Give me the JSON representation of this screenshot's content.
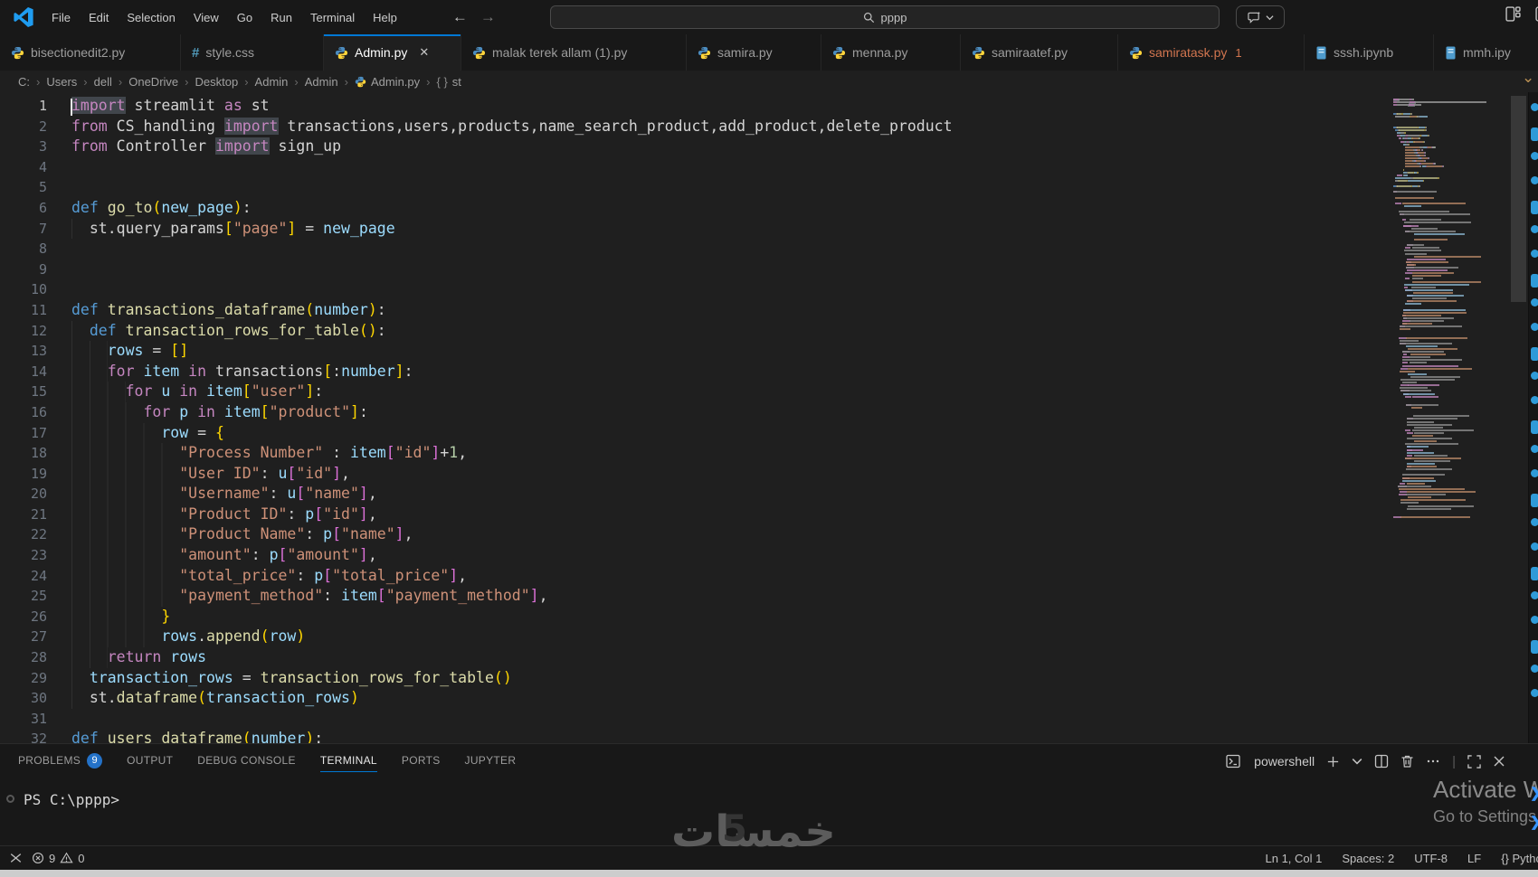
{
  "titlebar": {
    "menus": [
      "File",
      "Edit",
      "Selection",
      "View",
      "Go",
      "Run",
      "Terminal",
      "Help"
    ],
    "search_value": "pppp"
  },
  "tabs": [
    {
      "label": "bisectionedit2.py",
      "icon": "python"
    },
    {
      "label": "style.css",
      "icon": "css"
    },
    {
      "label": "Admin.py",
      "icon": "python",
      "active": true,
      "close": true
    },
    {
      "label": "malak terek allam (1).py",
      "icon": "python"
    },
    {
      "label": "samira.py",
      "icon": "python"
    },
    {
      "label": "menna.py",
      "icon": "python"
    },
    {
      "label": "samiraatef.py",
      "icon": "python"
    },
    {
      "label": "samiratask.py",
      "icon": "python",
      "badge": "1",
      "error": true
    },
    {
      "label": "sssh.ipynb",
      "icon": "notebook"
    },
    {
      "label": "mmh.ipy",
      "icon": "notebook"
    }
  ],
  "breadcrumbs": [
    {
      "label": "C:"
    },
    {
      "label": "Users"
    },
    {
      "label": "dell"
    },
    {
      "label": "OneDrive"
    },
    {
      "label": "Desktop"
    },
    {
      "label": "Admin"
    },
    {
      "label": "Admin"
    },
    {
      "label": "Admin.py",
      "icon": "python"
    },
    {
      "label": "st",
      "icon": "braces"
    }
  ],
  "code": {
    "lines": [
      {
        "n": 1,
        "ind": 0,
        "t": [
          [
            "k hl cur",
            "import"
          ],
          [
            "p",
            " streamlit "
          ],
          [
            "k",
            "as"
          ],
          [
            "p",
            " st"
          ]
        ]
      },
      {
        "n": 2,
        "ind": 0,
        "t": [
          [
            "k",
            "from"
          ],
          [
            "p",
            " CS_handling "
          ],
          [
            "k hl",
            "import"
          ],
          [
            "p",
            " transactions,users,products,name_search_product,add_product,delete_product"
          ]
        ]
      },
      {
        "n": 3,
        "ind": 0,
        "t": [
          [
            "k",
            "from"
          ],
          [
            "p",
            " Controller "
          ],
          [
            "k hl",
            "import"
          ],
          [
            "p",
            " sign_up"
          ]
        ]
      },
      {
        "n": 4,
        "ind": 0,
        "t": []
      },
      {
        "n": 5,
        "ind": 0,
        "t": []
      },
      {
        "n": 6,
        "ind": 0,
        "t": [
          [
            "d",
            "def"
          ],
          [
            "p",
            " "
          ],
          [
            "f",
            "go_to"
          ],
          [
            "b1",
            "("
          ],
          [
            "v",
            "new_page"
          ],
          [
            "b1",
            ")"
          ],
          [
            "p",
            ":"
          ]
        ]
      },
      {
        "n": 7,
        "ind": 2,
        "t": [
          [
            "p",
            "st.query_params"
          ],
          [
            "b1",
            "["
          ],
          [
            "s",
            "\"page\""
          ],
          [
            "b1",
            "]"
          ],
          [
            "p",
            " = "
          ],
          [
            "v",
            "new_page"
          ]
        ]
      },
      {
        "n": 8,
        "ind": 0,
        "t": []
      },
      {
        "n": 9,
        "ind": 0,
        "t": []
      },
      {
        "n": 10,
        "ind": 0,
        "t": []
      },
      {
        "n": 11,
        "ind": 0,
        "t": [
          [
            "d",
            "def"
          ],
          [
            "p",
            " "
          ],
          [
            "f",
            "transactions_dataframe"
          ],
          [
            "b1",
            "("
          ],
          [
            "v",
            "number"
          ],
          [
            "b1",
            ")"
          ],
          [
            "p",
            ":"
          ]
        ]
      },
      {
        "n": 12,
        "ind": 2,
        "t": [
          [
            "d",
            "def"
          ],
          [
            "p",
            " "
          ],
          [
            "f",
            "transaction_rows_for_table"
          ],
          [
            "b1",
            "()"
          ],
          [
            "p",
            ":"
          ]
        ]
      },
      {
        "n": 13,
        "ind": 4,
        "t": [
          [
            "v",
            "rows"
          ],
          [
            "p",
            " = "
          ],
          [
            "b1",
            "[]"
          ]
        ]
      },
      {
        "n": 14,
        "ind": 4,
        "t": [
          [
            "k",
            "for"
          ],
          [
            "p",
            " "
          ],
          [
            "v",
            "item"
          ],
          [
            "p",
            " "
          ],
          [
            "k",
            "in"
          ],
          [
            "p",
            " transactions"
          ],
          [
            "b1",
            "["
          ],
          [
            "p",
            ":"
          ],
          [
            "v",
            "number"
          ],
          [
            "b1",
            "]"
          ],
          [
            "p",
            ":"
          ]
        ]
      },
      {
        "n": 15,
        "ind": 6,
        "t": [
          [
            "k",
            "for"
          ],
          [
            "p",
            " "
          ],
          [
            "v",
            "u"
          ],
          [
            "p",
            " "
          ],
          [
            "k",
            "in"
          ],
          [
            "p",
            " "
          ],
          [
            "v",
            "item"
          ],
          [
            "b1",
            "["
          ],
          [
            "s",
            "\"user\""
          ],
          [
            "b1",
            "]"
          ],
          [
            "p",
            ":"
          ]
        ]
      },
      {
        "n": 16,
        "ind": 8,
        "t": [
          [
            "k",
            "for"
          ],
          [
            "p",
            " "
          ],
          [
            "v",
            "p"
          ],
          [
            "p",
            " "
          ],
          [
            "k",
            "in"
          ],
          [
            "p",
            " "
          ],
          [
            "v",
            "item"
          ],
          [
            "b1",
            "["
          ],
          [
            "s",
            "\"product\""
          ],
          [
            "b1",
            "]"
          ],
          [
            "p",
            ":"
          ]
        ]
      },
      {
        "n": 17,
        "ind": 10,
        "t": [
          [
            "v",
            "row"
          ],
          [
            "p",
            " = "
          ],
          [
            "b1",
            "{"
          ]
        ]
      },
      {
        "n": 18,
        "ind": 12,
        "t": [
          [
            "s",
            "\"Process Number\""
          ],
          [
            "p",
            " : "
          ],
          [
            "v",
            "item"
          ],
          [
            "b2",
            "["
          ],
          [
            "s",
            "\"id\""
          ],
          [
            "b2",
            "]"
          ],
          [
            "p",
            "+"
          ],
          [
            "n",
            "1"
          ],
          [
            "p",
            ","
          ]
        ]
      },
      {
        "n": 19,
        "ind": 12,
        "t": [
          [
            "s",
            "\"User ID\""
          ],
          [
            "p",
            ": "
          ],
          [
            "v",
            "u"
          ],
          [
            "b2",
            "["
          ],
          [
            "s",
            "\"id\""
          ],
          [
            "b2",
            "]"
          ],
          [
            "p",
            ","
          ]
        ]
      },
      {
        "n": 20,
        "ind": 12,
        "t": [
          [
            "s",
            "\"Username\""
          ],
          [
            "p",
            ": "
          ],
          [
            "v",
            "u"
          ],
          [
            "b2",
            "["
          ],
          [
            "s",
            "\"name\""
          ],
          [
            "b2",
            "]"
          ],
          [
            "p",
            ","
          ]
        ]
      },
      {
        "n": 21,
        "ind": 12,
        "t": [
          [
            "s",
            "\"Product ID\""
          ],
          [
            "p",
            ": "
          ],
          [
            "v",
            "p"
          ],
          [
            "b2",
            "["
          ],
          [
            "s",
            "\"id\""
          ],
          [
            "b2",
            "]"
          ],
          [
            "p",
            ","
          ]
        ]
      },
      {
        "n": 22,
        "ind": 12,
        "t": [
          [
            "s",
            "\"Product Name\""
          ],
          [
            "p",
            ": "
          ],
          [
            "v",
            "p"
          ],
          [
            "b2",
            "["
          ],
          [
            "s",
            "\"name\""
          ],
          [
            "b2",
            "]"
          ],
          [
            "p",
            ","
          ]
        ]
      },
      {
        "n": 23,
        "ind": 12,
        "t": [
          [
            "s",
            "\"amount\""
          ],
          [
            "p",
            ": "
          ],
          [
            "v",
            "p"
          ],
          [
            "b2",
            "["
          ],
          [
            "s",
            "\"amount\""
          ],
          [
            "b2",
            "]"
          ],
          [
            "p",
            ","
          ]
        ]
      },
      {
        "n": 24,
        "ind": 12,
        "t": [
          [
            "s",
            "\"total_price\""
          ],
          [
            "p",
            ": "
          ],
          [
            "v",
            "p"
          ],
          [
            "b2",
            "["
          ],
          [
            "s",
            "\"total_price\""
          ],
          [
            "b2",
            "]"
          ],
          [
            "p",
            ","
          ]
        ]
      },
      {
        "n": 25,
        "ind": 12,
        "t": [
          [
            "s",
            "\"payment_method\""
          ],
          [
            "p",
            ": "
          ],
          [
            "v",
            "item"
          ],
          [
            "b2",
            "["
          ],
          [
            "s",
            "\"payment_method\""
          ],
          [
            "b2",
            "]"
          ],
          [
            "p",
            ","
          ]
        ]
      },
      {
        "n": 26,
        "ind": 10,
        "t": [
          [
            "b1",
            "}"
          ]
        ]
      },
      {
        "n": 27,
        "ind": 10,
        "t": [
          [
            "v",
            "rows"
          ],
          [
            "p",
            "."
          ],
          [
            "f",
            "append"
          ],
          [
            "b1",
            "("
          ],
          [
            "v",
            "row"
          ],
          [
            "b1",
            ")"
          ]
        ]
      },
      {
        "n": 28,
        "ind": 4,
        "t": [
          [
            "k",
            "return"
          ],
          [
            "p",
            " "
          ],
          [
            "v",
            "rows"
          ]
        ]
      },
      {
        "n": 29,
        "ind": 2,
        "t": [
          [
            "v",
            "transaction_rows"
          ],
          [
            "p",
            " = "
          ],
          [
            "f",
            "transaction_rows_for_table"
          ],
          [
            "b1",
            "()"
          ]
        ]
      },
      {
        "n": 30,
        "ind": 2,
        "t": [
          [
            "p",
            "st."
          ],
          [
            "f",
            "dataframe"
          ],
          [
            "b1",
            "("
          ],
          [
            "v",
            "transaction_rows"
          ],
          [
            "b1",
            ")"
          ]
        ]
      },
      {
        "n": 31,
        "ind": 0,
        "t": []
      },
      {
        "n": 32,
        "ind": 0,
        "t": [
          [
            "d",
            "def"
          ],
          [
            "p",
            " "
          ],
          [
            "f",
            "users_dataframe"
          ],
          [
            "b1",
            "("
          ],
          [
            "v",
            "number"
          ],
          [
            "b1",
            ")"
          ],
          [
            "p",
            ":"
          ]
        ]
      }
    ]
  },
  "panel": {
    "tabs": [
      {
        "label": "PROBLEMS",
        "badge": "9"
      },
      {
        "label": "OUTPUT"
      },
      {
        "label": "DEBUG CONSOLE"
      },
      {
        "label": "TERMINAL",
        "active": true
      },
      {
        "label": "PORTS"
      },
      {
        "label": "JUPYTER"
      }
    ],
    "shell_label": "powershell",
    "prompt": "PS C:\\pppp>"
  },
  "status": {
    "errors": "9",
    "warnings": "0",
    "items": [
      "Ln 1, Col 1",
      "Spaces: 2",
      "UTF-8",
      "LF",
      "{} Python"
    ]
  },
  "watermark": {
    "brand": "خمسات",
    "five": "5",
    "activate_line1": "Activate W",
    "activate_line2": "Go to Settings"
  },
  "colors": {
    "accent": "#0078d4",
    "error_tab": "#d1754f",
    "badge": "#2472c8"
  }
}
